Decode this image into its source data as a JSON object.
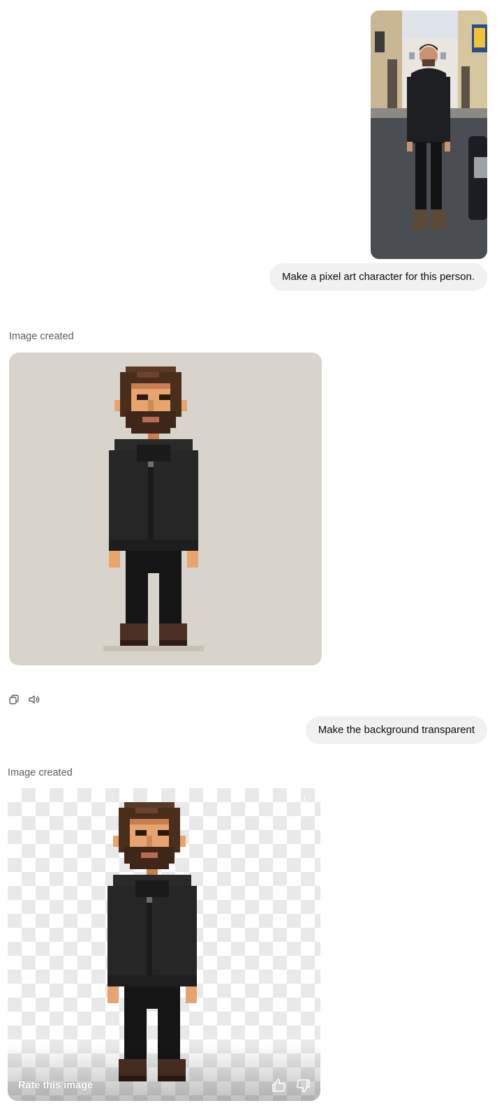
{
  "conversation": {
    "user_message_1": "Make a pixel art character for this person.",
    "assistant_label_1": "Image created",
    "user_message_2": "Make the background transparent",
    "assistant_label_2": "Image created",
    "rate_label": "Rate this image"
  },
  "icons": {
    "copy": "copy-icon",
    "read_aloud": "speaker-icon",
    "download": "download-icon",
    "thumbs_up": "thumbs-up-icon",
    "thumbs_down": "thumbs-down-icon"
  },
  "colors": {
    "bubble_bg": "#f1f1f1",
    "image1_bg": "#d9d4cb",
    "hair": "#4a2e1c",
    "skin": "#e8a46e",
    "jacket": "#262626",
    "boots": "#4b2f22"
  }
}
